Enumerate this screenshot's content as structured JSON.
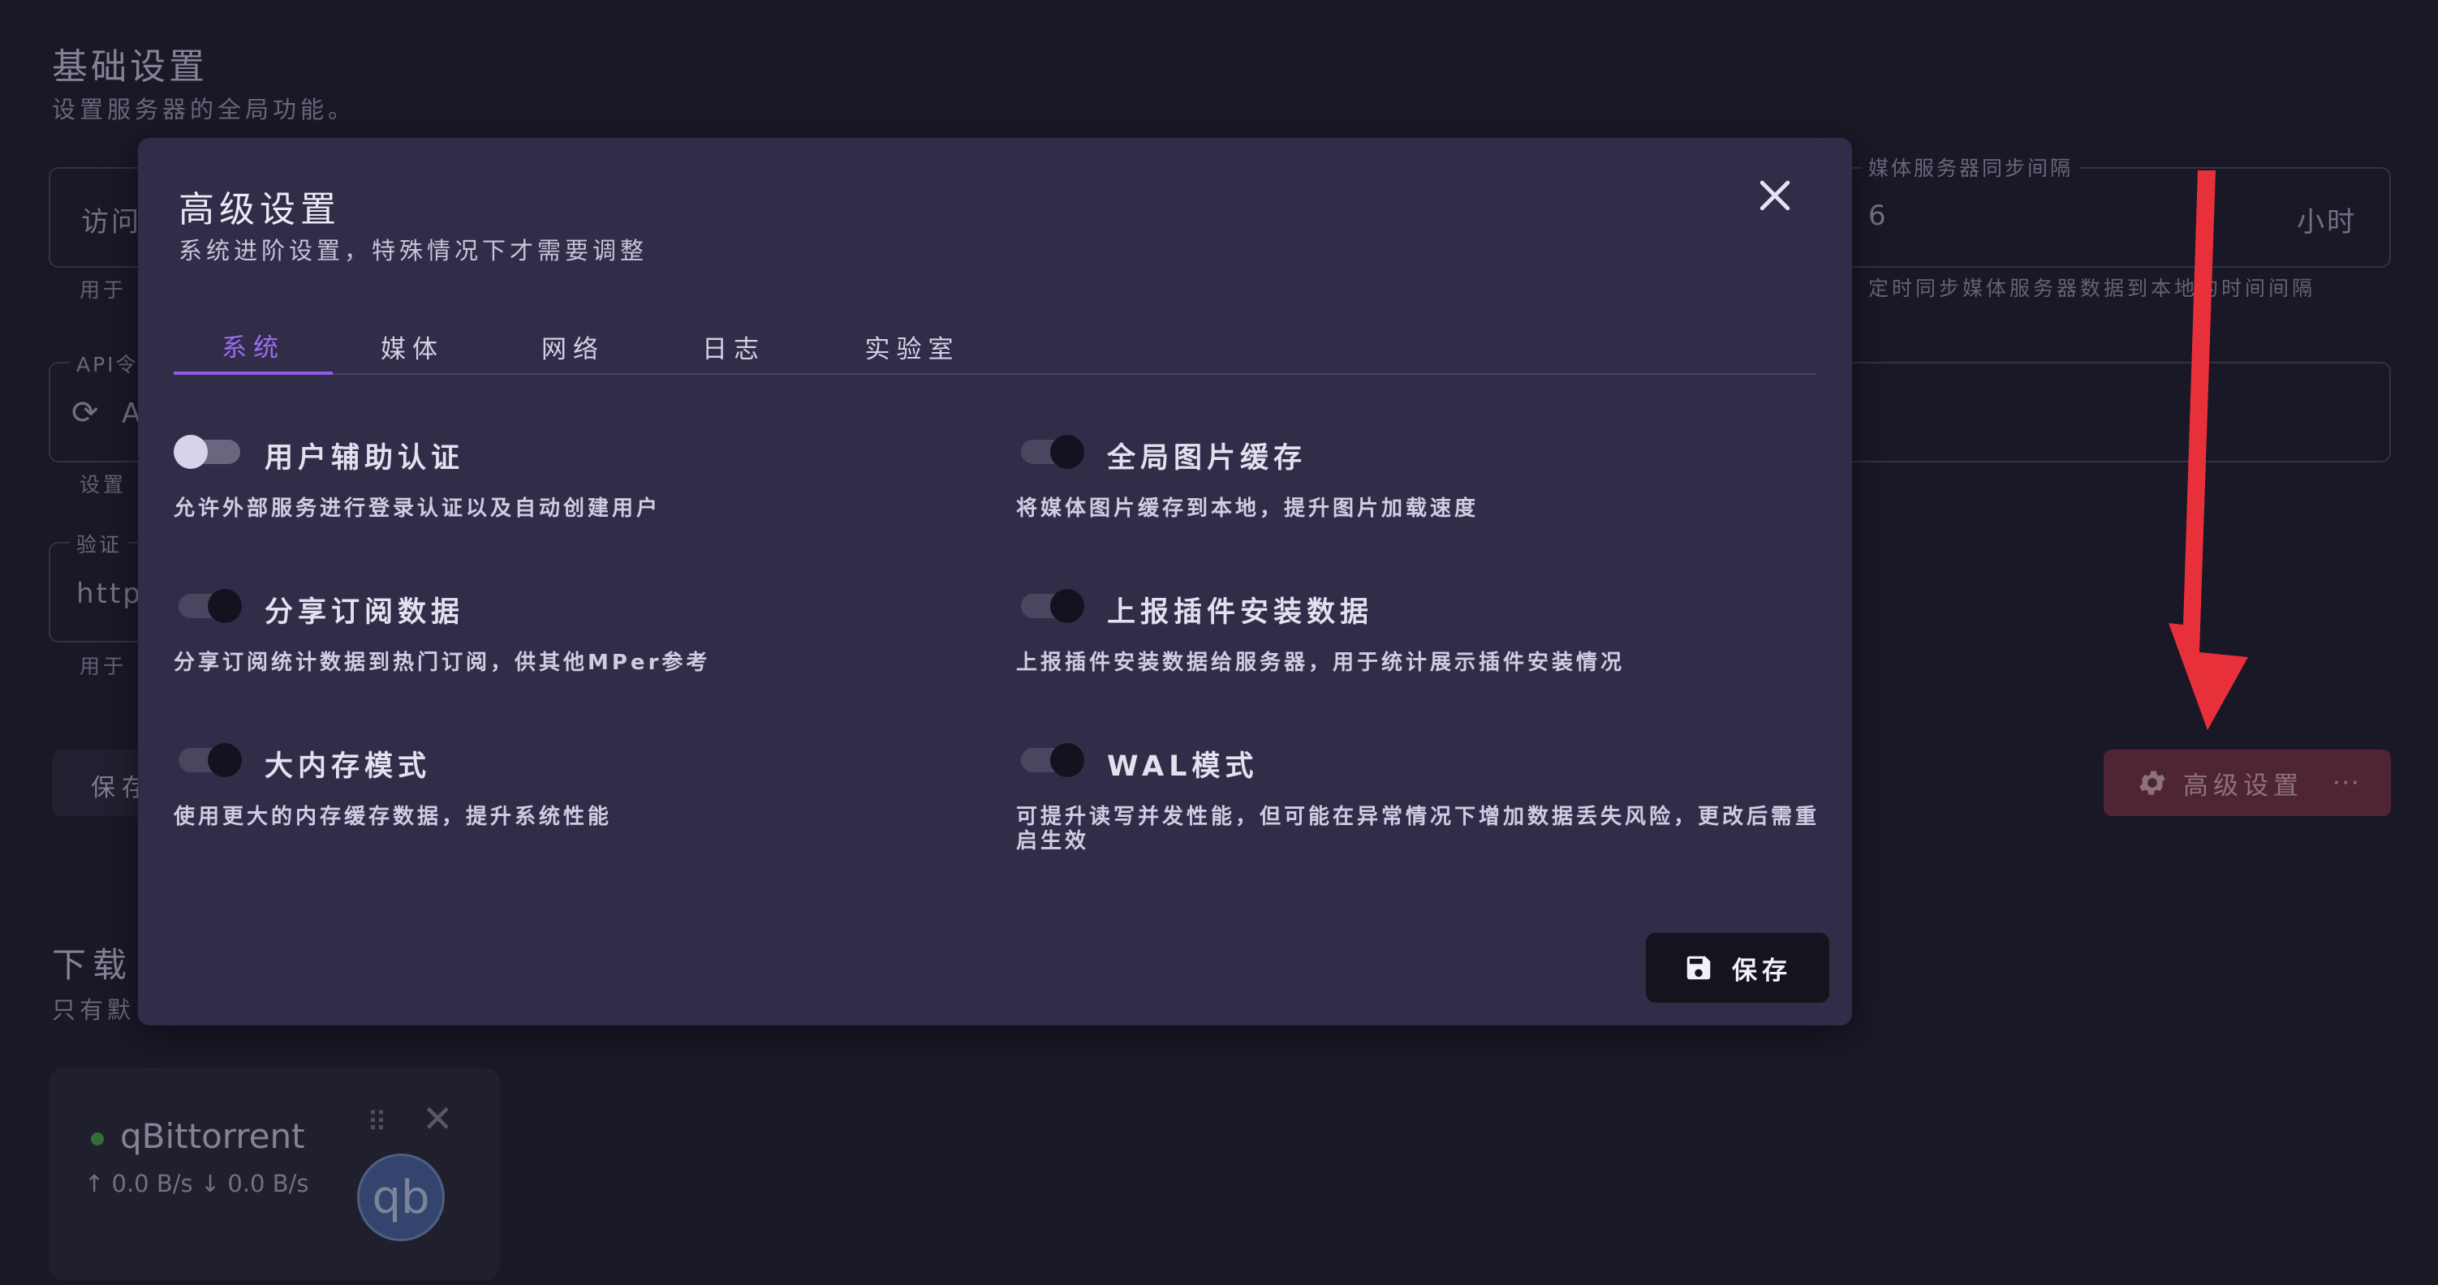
{
  "background": {
    "title": "基础设置",
    "subtitle": "设置服务器的全局功能。",
    "field_access_value": "访问",
    "field_access_hint": "用于",
    "field_api_label": "API令",
    "field_api_value": "A",
    "field_api_hint": "设置",
    "field_verify_label": "验证",
    "field_verify_value": "http",
    "field_verify_hint": "用于",
    "sync_label": "媒体服务器同步间隔",
    "sync_value": "6",
    "sync_unit": "小时",
    "sync_hint": "定时同步媒体服务器数据到本地的时间间隔",
    "save_label": "保存",
    "advanced_button_label": "高级设置",
    "more_label": "···",
    "downloader_title": "下载",
    "downloader_subtitle": "只有默",
    "downloader": {
      "name": "qBittorrent",
      "speed": "↑ 0.0 B/s  ↓ 0.0 B/s",
      "logo_text": "qb",
      "status_color": "#4caf50"
    }
  },
  "dialog": {
    "title": "高级设置",
    "subtitle": "系统进阶设置，特殊情况下才需要调整",
    "tabs": [
      {
        "label": "系统",
        "active": true
      },
      {
        "label": "媒体",
        "active": false
      },
      {
        "label": "网络",
        "active": false
      },
      {
        "label": "日志",
        "active": false
      },
      {
        "label": "实验室",
        "active": false
      }
    ],
    "settings": [
      {
        "label": "用户辅助认证",
        "desc": "允许外部服务进行登录认证以及自动创建用户",
        "enabled": false
      },
      {
        "label": "全局图片缓存",
        "desc": "将媒体图片缓存到本地，提升图片加载速度",
        "enabled": true
      },
      {
        "label": "分享订阅数据",
        "desc": "分享订阅统计数据到热门订阅，供其他MPer参考",
        "enabled": true
      },
      {
        "label": "上报插件安装数据",
        "desc": "上报插件安装数据给服务器，用于统计展示插件安装情况",
        "enabled": true
      },
      {
        "label": "大内存模式",
        "desc": "使用更大的内存缓存数据，提升系统性能",
        "enabled": true
      },
      {
        "label": "WAL模式",
        "desc": "可提升读写并发性能，但可能在异常情况下增加数据丢失风险，更改后需重启生效",
        "enabled": true
      }
    ],
    "save_label": "保存"
  },
  "colors": {
    "accent": "#8c5ce6",
    "dialog_bg": "#312d48",
    "arrow": "#e8303a"
  }
}
